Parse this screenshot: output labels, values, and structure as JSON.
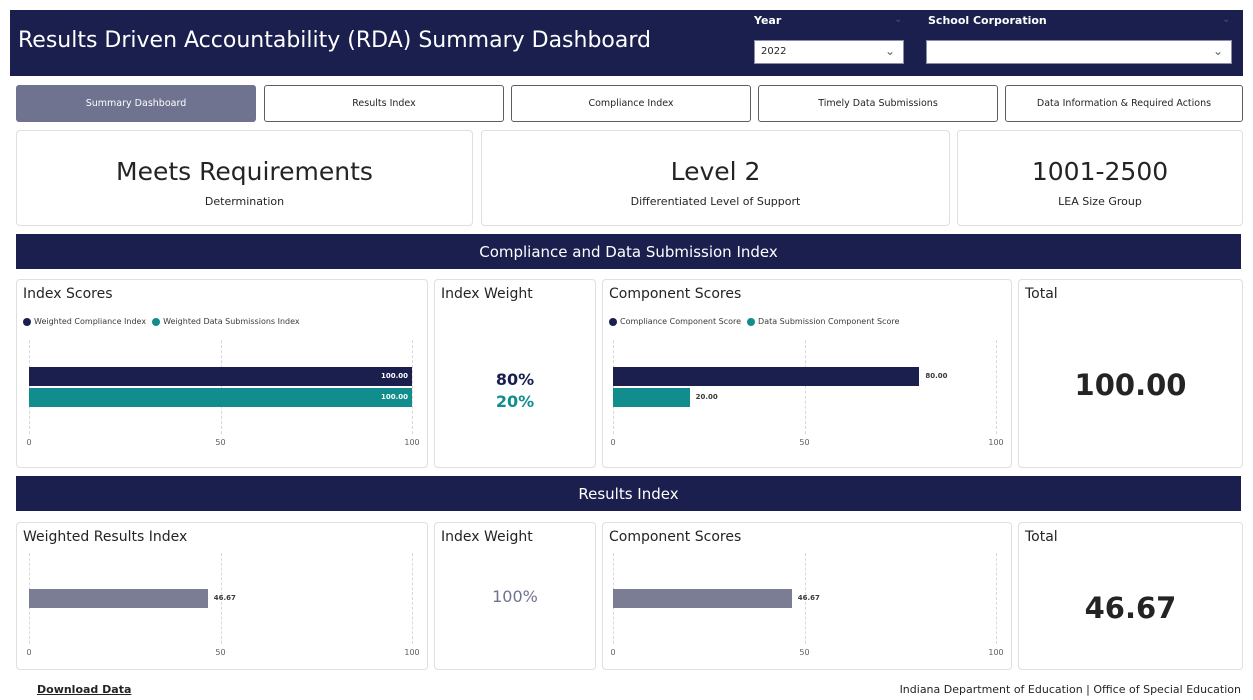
{
  "header": {
    "title": "Results Driven Accountability (RDA) Summary Dashboard",
    "year_label": "Year",
    "year_value": "2022",
    "school_corp_label": "School Corporation",
    "school_corp_value": ""
  },
  "nav": {
    "tabs": [
      {
        "label": "Summary Dashboard",
        "active": true
      },
      {
        "label": "Results Index",
        "active": false
      },
      {
        "label": "Compliance Index",
        "active": false
      },
      {
        "label": "Timely Data Submissions",
        "active": false
      },
      {
        "label": "Data Information & Required Actions",
        "active": false
      }
    ]
  },
  "kpis": {
    "determination": {
      "value": "Meets Requirements",
      "label": "Determination"
    },
    "support": {
      "value": "Level 2",
      "label": "Differentiated Level of Support"
    },
    "size": {
      "value": "1001-2500",
      "label": "LEA Size Group"
    }
  },
  "compliance": {
    "band_title": "Compliance and Data Submission Index",
    "index_scores_title": "Index Scores",
    "index_weight_title": "Index Weight",
    "component_scores_title": "Component Scores",
    "total_title": "Total",
    "weight_1": "80%",
    "weight_2": "20%",
    "total_value": "100.00"
  },
  "results": {
    "band_title": "Results Index",
    "weighted_title": "Weighted Results Index",
    "index_weight_title": "Index Weight",
    "component_scores_title": "Component Scores",
    "total_title": "Total",
    "weight": "100%",
    "total_value": "46.67"
  },
  "footer": {
    "download_label": "Download Data",
    "org_label": "Indiana Department of Education | Office of Special Education"
  },
  "colors": {
    "navy": "#1a1f4e",
    "teal": "#118d8e",
    "slate": "#6f7390",
    "gray_bar": "#7a7d94"
  },
  "chart_data": [
    {
      "type": "bar",
      "orientation": "horizontal",
      "title": "Index Scores",
      "series": [
        {
          "name": "Weighted Compliance Index",
          "values": [
            100.0
          ],
          "color": "#1a1f4e",
          "label": "100.00"
        },
        {
          "name": "Weighted Data Submissions Index",
          "values": [
            100.0
          ],
          "color": "#118d8e",
          "label": "100.00"
        }
      ],
      "xlim": [
        0,
        100
      ],
      "ticks": [
        "0",
        "50",
        "100"
      ],
      "grid": true,
      "legend": "top-left"
    },
    {
      "type": "bar",
      "orientation": "horizontal",
      "title": "Component Scores",
      "series": [
        {
          "name": "Compliance Component Score",
          "values": [
            80.0
          ],
          "color": "#1a1f4e",
          "label": "80.00"
        },
        {
          "name": "Data Submission Component Score",
          "values": [
            20.0
          ],
          "color": "#118d8e",
          "label": "20.00"
        }
      ],
      "xlim": [
        0,
        100
      ],
      "ticks": [
        "0",
        "50",
        "100"
      ],
      "grid": true,
      "legend": "top-left"
    },
    {
      "type": "bar",
      "orientation": "horizontal",
      "title": "Weighted Results Index",
      "series": [
        {
          "values": [
            46.67
          ],
          "color": "#7a7d94",
          "label": "46.67"
        }
      ],
      "xlim": [
        0,
        100
      ],
      "ticks": [
        "0",
        "50",
        "100"
      ],
      "grid": true
    },
    {
      "type": "bar",
      "orientation": "horizontal",
      "title": "Component Scores",
      "series": [
        {
          "values": [
            46.67
          ],
          "color": "#7a7d94",
          "label": "46.67"
        }
      ],
      "xlim": [
        0,
        100
      ],
      "ticks": [
        "0",
        "50",
        "100"
      ],
      "grid": true
    }
  ]
}
